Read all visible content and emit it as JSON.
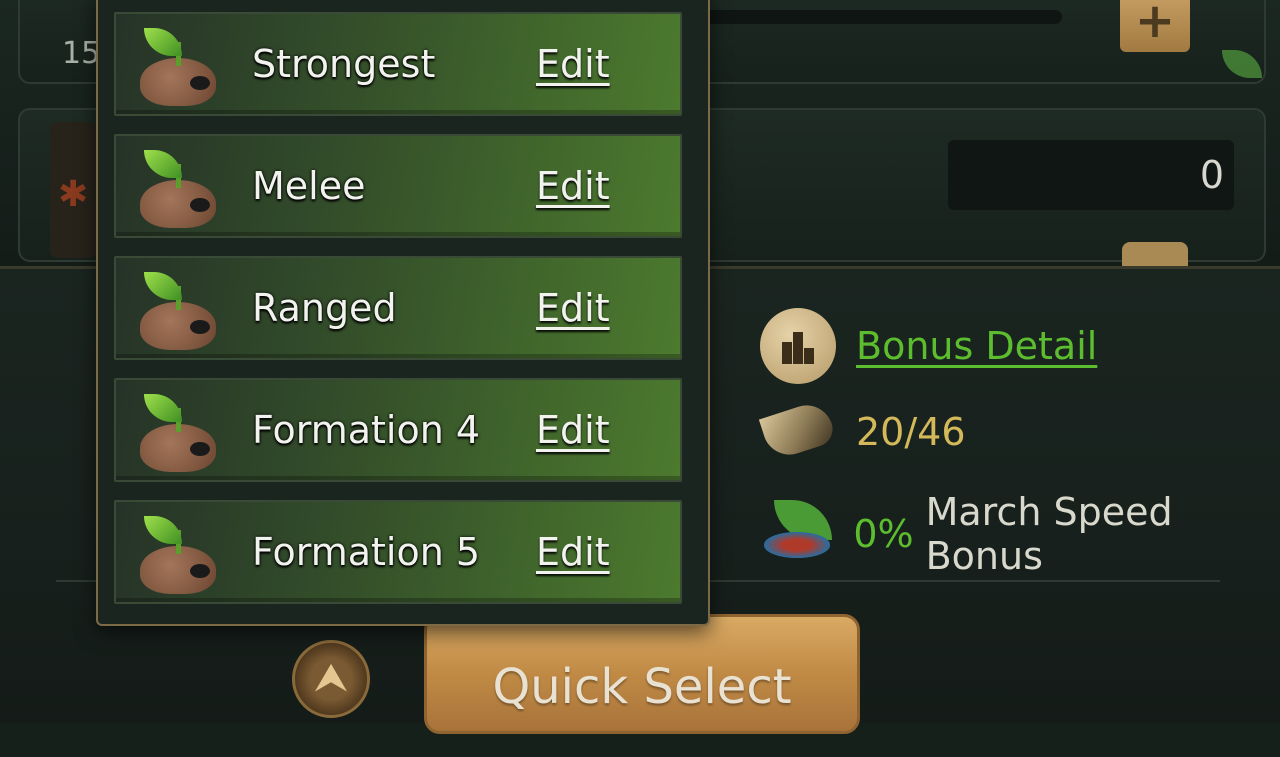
{
  "background": {
    "top_card": {
      "partial_count": "15",
      "add_icon": "plus-icon"
    },
    "troop_card": {
      "count_value": "0"
    }
  },
  "formations": [
    {
      "name": "Strongest",
      "edit_label": "Edit"
    },
    {
      "name": "Melee",
      "edit_label": "Edit"
    },
    {
      "name": "Ranged",
      "edit_label": "Edit"
    },
    {
      "name": "Formation 4",
      "edit_label": "Edit"
    },
    {
      "name": "Formation 5",
      "edit_label": "Edit"
    }
  ],
  "stats": {
    "bonus_detail_label": "Bonus Detail",
    "horn_count": "20/46",
    "march_speed_percent": "0%",
    "march_speed_label": "March Speed Bonus"
  },
  "bottom_bar": {
    "collapse_icon": "chevron-up-icon",
    "collapse_glyph": "⮝",
    "quick_select_label": "Quick Select"
  },
  "colors": {
    "accent_green": "#5cbd2e",
    "horn_gold": "#d4b95a",
    "button_gold": "#c08a45"
  }
}
